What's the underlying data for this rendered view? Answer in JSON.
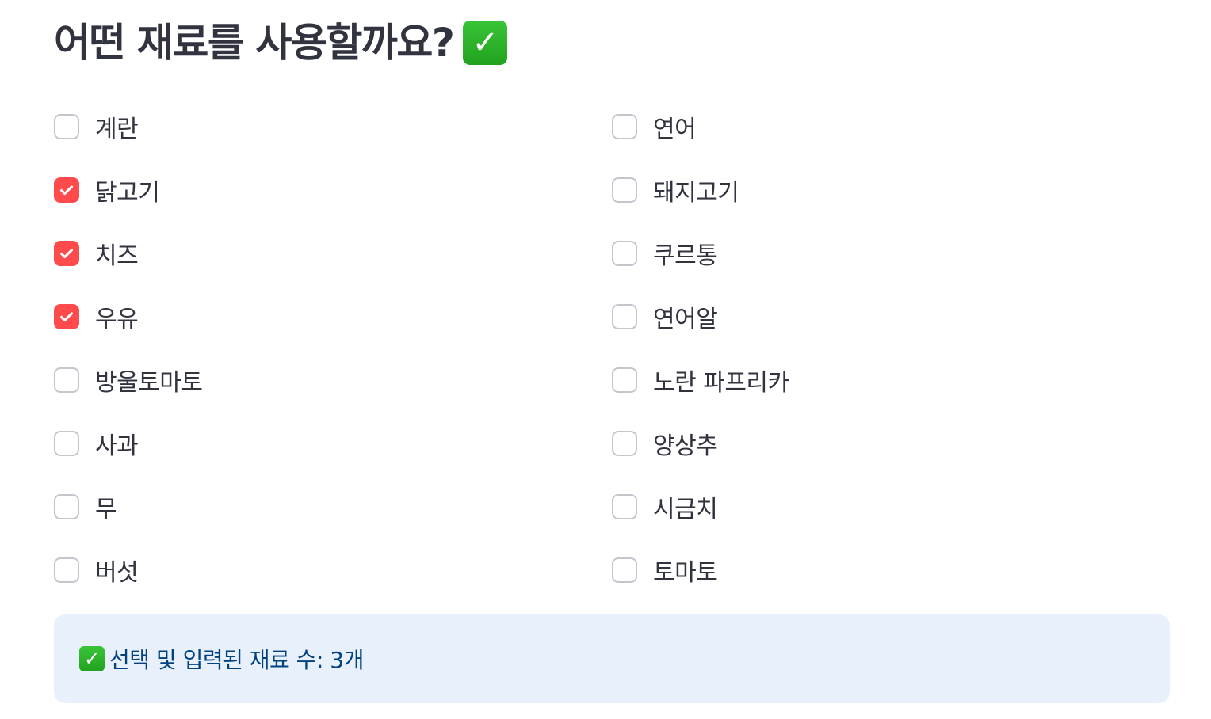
{
  "header": {
    "title": "어떤 재료를 사용할까요?",
    "title_icon": "check-mark-button-icon"
  },
  "ingredients": {
    "left": [
      {
        "label": "계란",
        "checked": false
      },
      {
        "label": "닭고기",
        "checked": true
      },
      {
        "label": "치즈",
        "checked": true
      },
      {
        "label": "우유",
        "checked": true
      },
      {
        "label": "방울토마토",
        "checked": false
      },
      {
        "label": "사과",
        "checked": false
      },
      {
        "label": "무",
        "checked": false
      },
      {
        "label": "버섯",
        "checked": false
      }
    ],
    "right": [
      {
        "label": "연어",
        "checked": false
      },
      {
        "label": "돼지고기",
        "checked": false
      },
      {
        "label": "쿠르통",
        "checked": false
      },
      {
        "label": "연어알",
        "checked": false
      },
      {
        "label": "노란 파프리카",
        "checked": false
      },
      {
        "label": "양상추",
        "checked": false
      },
      {
        "label": "시금치",
        "checked": false
      },
      {
        "label": "토마토",
        "checked": false
      }
    ]
  },
  "info_box": {
    "icon": "check-mark-button-icon",
    "text": "선택 및 입력된 재료 수: 3개"
  },
  "colors": {
    "checkbox_checked": "#ff4b4b",
    "checkbox_border": "#c4c6cd",
    "info_background": "#e8f0fb",
    "info_text": "#004280",
    "emoji_green": "#2fb62c"
  }
}
